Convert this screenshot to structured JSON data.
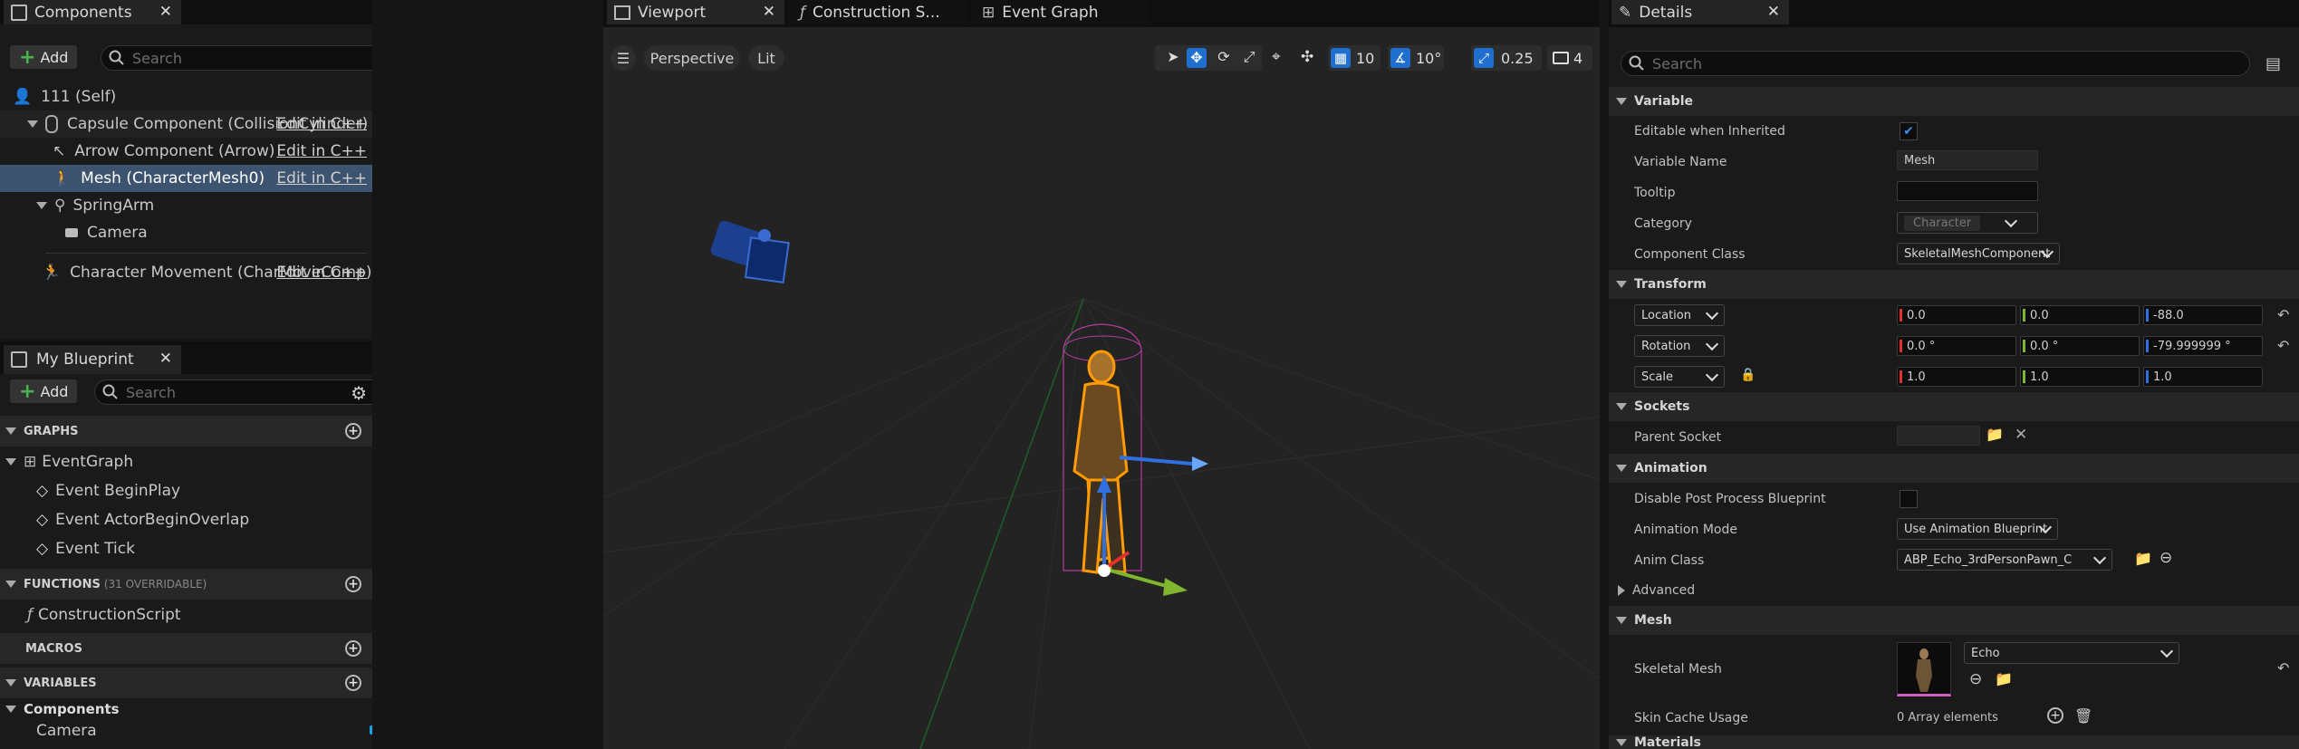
{
  "components": {
    "tab_title": "Components",
    "add_label": "Add",
    "search_placeholder": "Search",
    "items": [
      {
        "label": "111 (Self)"
      },
      {
        "label": "Capsule Component (CollisionCylinder)",
        "edit": "Edit in C++"
      },
      {
        "label": "Arrow Component (Arrow)",
        "edit": "Edit in C++"
      },
      {
        "label": "Mesh (CharacterMesh0)",
        "edit": "Edit in C++"
      },
      {
        "label": "SpringArm"
      },
      {
        "label": "Camera"
      },
      {
        "label": "Character Movement (CharMoveComp)",
        "edit": "Edit in C++"
      }
    ]
  },
  "blueprint": {
    "tab_title": "My Blueprint",
    "add_label": "Add",
    "search_placeholder": "Search",
    "graphs_header": "GRAPHS",
    "event_graph": "EventGraph",
    "events": [
      "Event BeginPlay",
      "Event ActorBeginOverlap",
      "Event Tick"
    ],
    "functions_header": "FUNCTIONS",
    "functions_note": "(31 OVERRIDABLE)",
    "construction_script": "ConstructionScript",
    "macros_header": "MACROS",
    "variables_header": "VARIABLES",
    "components_group": "Components",
    "camera_var": "Camera"
  },
  "viewport": {
    "tabs": [
      "Viewport",
      "Construction S...",
      "Event Graph"
    ],
    "perspective": "Perspective",
    "lit": "Lit",
    "grid_snap": "10",
    "angle_snap": "10°",
    "scale_snap": "0.25",
    "camera_speed": "4"
  },
  "details": {
    "tab_title": "Details",
    "search_placeholder": "Search",
    "variable_header": "Variable",
    "editable_label": "Editable when Inherited",
    "varname_label": "Variable Name",
    "varname_value": "Mesh",
    "tooltip_label": "Tooltip",
    "category_label": "Category",
    "category_value": "Character",
    "compclass_label": "Component Class",
    "compclass_value": "SkeletalMeshComponent",
    "transform_header": "Transform",
    "location_label": "Location",
    "location": [
      "0.0",
      "0.0",
      "-88.0"
    ],
    "rotation_label": "Rotation",
    "rotation": [
      "0.0 °",
      "0.0 °",
      "-79.999999 °"
    ],
    "scale_label": "Scale",
    "scale": [
      "1.0",
      "1.0",
      "1.0"
    ],
    "sockets_header": "Sockets",
    "parent_socket_label": "Parent Socket",
    "animation_header": "Animation",
    "disable_pp_label": "Disable Post Process Blueprint",
    "anim_mode_label": "Animation Mode",
    "anim_mode_value": "Use Animation Blueprint",
    "anim_class_label": "Anim Class",
    "anim_class_value": "ABP_Echo_3rdPersonPawn_C",
    "advanced_label": "Advanced",
    "mesh_header": "Mesh",
    "skeletal_mesh_label": "Skeletal Mesh",
    "skeletal_mesh_value": "Echo",
    "skin_cache_label": "Skin Cache Usage",
    "skin_cache_value": "0 Array elements",
    "materials_header": "Materials"
  },
  "colors": {
    "selection": "#3d5470",
    "accent_blue": "#1f6fd0",
    "x_axis": "#e0312f",
    "y_axis": "#7fb52f",
    "z_axis": "#2f6fe0"
  }
}
